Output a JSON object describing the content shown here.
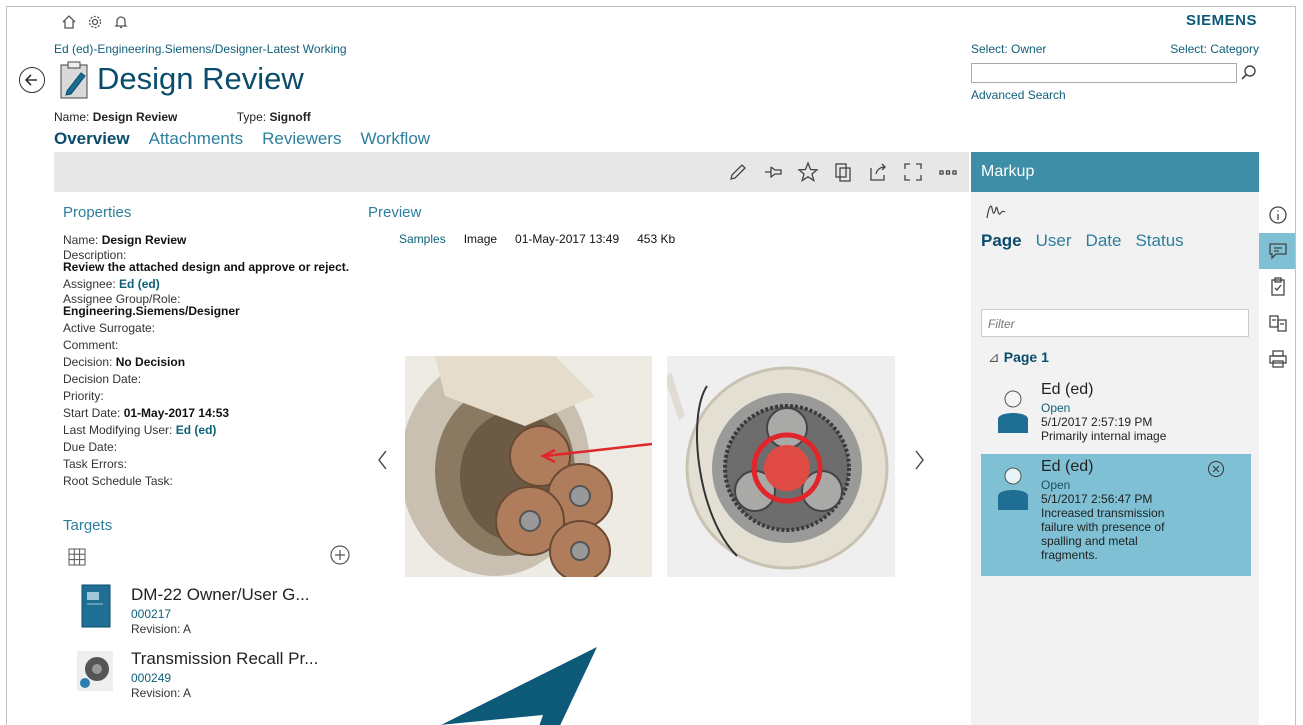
{
  "header": {
    "brand": "SIEMENS",
    "breadcrumb": "Ed (ed)-Engineering.Siemens/Designer-Latest Working",
    "title": "Design Review",
    "name_label": "Name:",
    "name_value": "Design Review",
    "type_label": "Type:",
    "type_value": "Signoff",
    "tabs": [
      "Overview",
      "Attachments",
      "Reviewers",
      "Workflow"
    ],
    "active_tab": "Overview"
  },
  "search": {
    "select_owner": "Select: Owner",
    "select_category": "Select: Category",
    "placeholder": "",
    "advanced": "Advanced Search"
  },
  "properties": {
    "heading": "Properties",
    "name_label": "Name:",
    "name_value": "Design Review",
    "description_label": "Description:",
    "description_value": "Review the attached design and approve or reject.",
    "assignee_label": "Assignee:",
    "assignee_value": "Ed (ed)",
    "group_label": "Assignee Group/Role:",
    "group_value": "Engineering.Siemens/Designer",
    "surrogate_label": "Active Surrogate:",
    "comment_label": "Comment:",
    "decision_label": "Decision:",
    "decision_value": "No Decision",
    "decision_date_label": "Decision Date:",
    "priority_label": "Priority:",
    "start_label": "Start Date:",
    "start_value": "01-May-2017 14:53",
    "last_mod_label": "Last Modifying User:",
    "last_mod_value": "Ed (ed)",
    "due_label": "Due Date:",
    "errors_label": "Task Errors:",
    "root_label": "Root Schedule Task:"
  },
  "preview": {
    "heading": "Preview",
    "dataset": "Samples",
    "kind": "Image",
    "date": "01-May-2017 13:49",
    "size": "453 Kb"
  },
  "targets": {
    "heading": "Targets",
    "items": [
      {
        "title": "DM-22 Owner/User G...",
        "id": "000217",
        "revision": "Revision:  A"
      },
      {
        "title": "Transmission Recall Pr...",
        "id": "000249",
        "revision": "Revision:  A"
      }
    ]
  },
  "markup": {
    "heading": "Markup",
    "tabs": [
      "Page",
      "User",
      "Date",
      "Status"
    ],
    "active_tab": "Page",
    "filter_placeholder": "Filter",
    "group": "Page 1",
    "group_glyph": "⊿",
    "entries": [
      {
        "user": "Ed (ed)",
        "status": "Open",
        "date": "5/1/2017 2:57:19 PM",
        "comment": "Primarily internal image",
        "selected": false
      },
      {
        "user": "Ed (ed)",
        "status": "Open",
        "date": "5/1/2017 2:56:47 PM",
        "comment": "Increased transmission failure with presence of spalling and metal fragments.",
        "selected": true
      }
    ]
  },
  "colors": {
    "accent": "#0a4c6b",
    "link": "#2d7f9c",
    "markup_header": "#3d8ea6",
    "selected": "#7fc0d4"
  }
}
